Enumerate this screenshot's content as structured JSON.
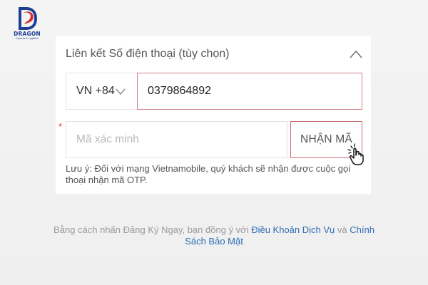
{
  "logo": {
    "icon": "dragon-logo-icon",
    "brand": "DRAGON",
    "tagline": "Express & Logistics",
    "colors": {
      "primary": "#1c3f94",
      "accent": "#d52b2b"
    }
  },
  "card": {
    "title": "Liên kết Số điện thoại (tùy chọn)",
    "collapse_icon": "chevron-up-icon"
  },
  "phone": {
    "country_code": "VN +84",
    "country_icon": "chevron-down-icon",
    "value": "0379864892"
  },
  "otp": {
    "required_mark": "*",
    "placeholder": "Mã xác minh",
    "button_label": "NHẬN MÃ"
  },
  "note": "Lưu ý: Đối với mạng Vietnamobile, quý khách sẽ nhận được cuộc gọi thoại nhận mã OTP.",
  "terms": {
    "prefix": "Bằng cách nhấn Đăng Ký Ngay, bạn đồng ý với",
    "link1": "Điều Khoản Dịch Vụ",
    "joiner": "và",
    "link2": "Chính Sách Bảo Mật"
  },
  "cursor_icon": "hand-pointer-icon",
  "colors": {
    "link": "#2f6db2",
    "focus_border": "#cf7f86",
    "required": "#e0442e",
    "card": "#ffffff",
    "background": "#f1f1f1"
  }
}
